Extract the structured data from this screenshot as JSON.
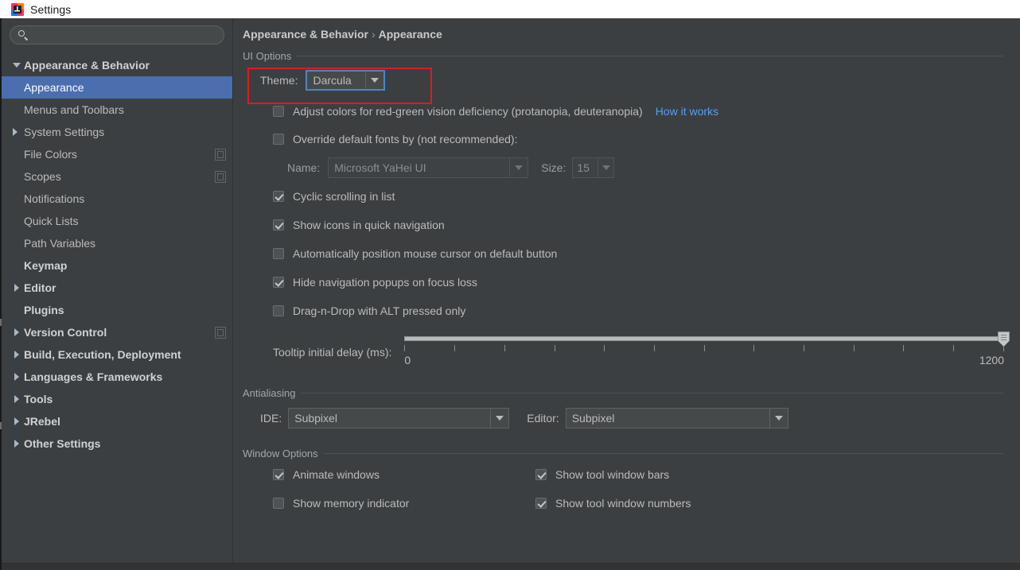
{
  "titlebar": {
    "title": "Settings",
    "icon": "intellij-idea-icon"
  },
  "sidebar": {
    "search": {
      "value": "",
      "placeholder": "",
      "icon": "search-icon"
    },
    "items": [
      {
        "label": "Appearance & Behavior",
        "depth": 0,
        "arrow": "down",
        "bold": true,
        "selected": false,
        "copy": false
      },
      {
        "label": "Appearance",
        "depth": 1,
        "arrow": "none",
        "bold": false,
        "selected": true,
        "copy": false
      },
      {
        "label": "Menus and Toolbars",
        "depth": 1,
        "arrow": "none",
        "bold": false,
        "selected": false,
        "copy": false
      },
      {
        "label": "System Settings",
        "depth": 1,
        "arrow": "right",
        "bold": false,
        "selected": false,
        "copy": false
      },
      {
        "label": "File Colors",
        "depth": 1,
        "arrow": "none",
        "bold": false,
        "selected": false,
        "copy": true
      },
      {
        "label": "Scopes",
        "depth": 1,
        "arrow": "none",
        "bold": false,
        "selected": false,
        "copy": true
      },
      {
        "label": "Notifications",
        "depth": 1,
        "arrow": "none",
        "bold": false,
        "selected": false,
        "copy": false
      },
      {
        "label": "Quick Lists",
        "depth": 1,
        "arrow": "none",
        "bold": false,
        "selected": false,
        "copy": false
      },
      {
        "label": "Path Variables",
        "depth": 1,
        "arrow": "none",
        "bold": false,
        "selected": false,
        "copy": false
      },
      {
        "label": "Keymap",
        "depth": 0,
        "arrow": "none",
        "bold": true,
        "selected": false,
        "copy": false
      },
      {
        "label": "Editor",
        "depth": 0,
        "arrow": "right",
        "bold": true,
        "selected": false,
        "copy": false
      },
      {
        "label": "Plugins",
        "depth": 0,
        "arrow": "none",
        "bold": true,
        "selected": false,
        "copy": false
      },
      {
        "label": "Version Control",
        "depth": 0,
        "arrow": "right",
        "bold": true,
        "selected": false,
        "copy": true
      },
      {
        "label": "Build, Execution, Deployment",
        "depth": 0,
        "arrow": "right",
        "bold": true,
        "selected": false,
        "copy": false
      },
      {
        "label": "Languages & Frameworks",
        "depth": 0,
        "arrow": "right",
        "bold": true,
        "selected": false,
        "copy": false
      },
      {
        "label": "Tools",
        "depth": 0,
        "arrow": "right",
        "bold": true,
        "selected": false,
        "copy": false
      },
      {
        "label": "JRebel",
        "depth": 0,
        "arrow": "right",
        "bold": true,
        "selected": false,
        "copy": false
      },
      {
        "label": "Other Settings",
        "depth": 0,
        "arrow": "right",
        "bold": true,
        "selected": false,
        "copy": false
      }
    ]
  },
  "breadcrumb": {
    "root": "Appearance & Behavior",
    "separator": "›",
    "leaf": "Appearance"
  },
  "ui_options": {
    "group_title": "UI Options",
    "theme": {
      "label": "Theme:",
      "value": "Darcula",
      "focused": true,
      "highlighted": true,
      "highlight_color": "#e11a1a"
    },
    "adjust_colors": {
      "label": "Adjust colors for red-green vision deficiency (protanopia, deuteranopia)",
      "checked": false,
      "link": "How it works",
      "link_color": "#589df6"
    },
    "override_fonts": {
      "label": "Override default fonts by (not recommended):",
      "checked": false
    },
    "font_name": {
      "label": "Name:",
      "value": "Microsoft YaHei UI",
      "disabled": true
    },
    "font_size": {
      "label": "Size:",
      "value": "15",
      "disabled": true
    },
    "checkboxes": [
      {
        "label": "Cyclic scrolling in list",
        "checked": true
      },
      {
        "label": "Show icons in quick navigation",
        "checked": true
      },
      {
        "label": "Automatically position mouse cursor on default button",
        "checked": false
      },
      {
        "label": "Hide navigation popups on focus loss",
        "checked": true
      },
      {
        "label": "Drag-n-Drop with ALT pressed only",
        "checked": false
      }
    ],
    "tooltip_delay": {
      "label": "Tooltip initial delay (ms):",
      "min": "0",
      "max": "1200",
      "value": "1200",
      "ticks": 13
    }
  },
  "antialiasing": {
    "group_title": "Antialiasing",
    "ide": {
      "label": "IDE:",
      "value": "Subpixel"
    },
    "editor": {
      "label": "Editor:",
      "value": "Subpixel"
    }
  },
  "window_options": {
    "group_title": "Window Options",
    "rows": [
      {
        "left": {
          "label": "Animate windows",
          "checked": true
        },
        "right": {
          "label": "Show tool window bars",
          "checked": true
        }
      },
      {
        "left": {
          "label": "Show memory indicator",
          "checked": false
        },
        "right": {
          "label": "Show tool window numbers",
          "checked": true
        }
      }
    ]
  },
  "colors": {
    "window_bg": "#3c3f41",
    "selection_blue": "#4b6eaf",
    "accent_link": "#589df6",
    "annotation_red": "#e11a1a",
    "focus_blue": "#4b86c8"
  }
}
